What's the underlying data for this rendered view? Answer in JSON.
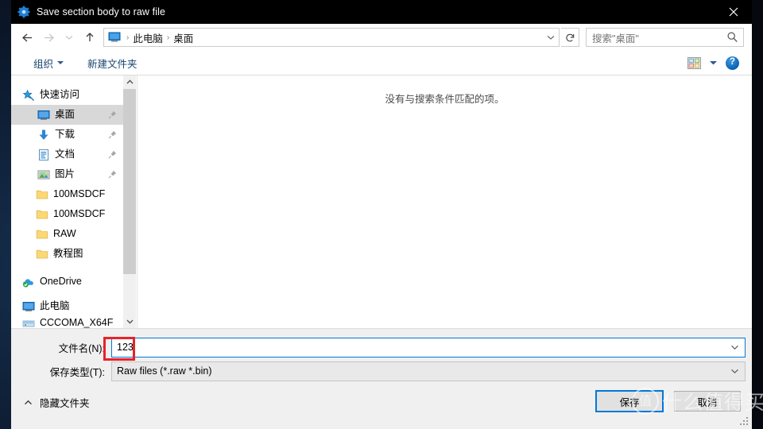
{
  "window": {
    "title": "Save section body to raw file",
    "title_icon": "gear-icon",
    "close_label": "✕"
  },
  "nav": {
    "back_icon": "arrow-left-icon",
    "forward_icon": "arrow-right-icon",
    "recent_icon": "chevron-down-icon",
    "up_icon": "arrow-up-icon",
    "breadcrumb": [
      {
        "label": "此电脑"
      },
      {
        "label": "桌面"
      }
    ],
    "separator": "›",
    "refresh_icon": "refresh-icon",
    "search_placeholder": "搜索\"桌面\"",
    "search_icon": "search-icon"
  },
  "toolbar": {
    "organize_label": "组织",
    "new_folder_label": "新建文件夹",
    "view_icon": "view-layout-icon",
    "view_dropdown_icon": "chevron-down-icon",
    "help_label": "?",
    "help_icon": "help-icon"
  },
  "sidebar": {
    "items": [
      {
        "label": "快速访问",
        "icon": "star-pin-icon",
        "level": 1,
        "selected": false,
        "pinned": false
      },
      {
        "label": "桌面",
        "icon": "desktop-icon",
        "level": 2,
        "selected": true,
        "pinned": true
      },
      {
        "label": "下载",
        "icon": "download-icon",
        "level": 2,
        "selected": false,
        "pinned": true
      },
      {
        "label": "文档",
        "icon": "document-icon",
        "level": 2,
        "selected": false,
        "pinned": true
      },
      {
        "label": "图片",
        "icon": "pictures-icon",
        "level": 2,
        "selected": false,
        "pinned": true
      },
      {
        "label": "100MSDCF",
        "icon": "folder-icon",
        "level": 2,
        "selected": false,
        "pinned": false
      },
      {
        "label": "100MSDCF",
        "icon": "folder-icon",
        "level": 2,
        "selected": false,
        "pinned": false
      },
      {
        "label": "RAW",
        "icon": "folder-icon",
        "level": 2,
        "selected": false,
        "pinned": false
      },
      {
        "label": "教程图",
        "icon": "folder-icon",
        "level": 2,
        "selected": false,
        "pinned": false
      },
      {
        "label": "OneDrive",
        "icon": "onedrive-icon",
        "level": 1,
        "selected": false,
        "pinned": false
      },
      {
        "label": "此电脑",
        "icon": "thispc-icon",
        "level": 1,
        "selected": false,
        "pinned": false
      }
    ],
    "clipped_item": {
      "label": "CCCOMA_X64F",
      "icon": "drive-icon"
    },
    "scroll_up_icon": "chevron-up-icon",
    "scroll_down_icon": "chevron-down-icon"
  },
  "content": {
    "empty_message": "没有与搜索条件匹配的项。"
  },
  "form": {
    "filename_label": "文件名(N):",
    "filename_value": "123",
    "savetype_label": "保存类型(T):",
    "savetype_value": "Raw files (*.raw *.bin)",
    "dropdown_icon": "chevron-down-icon"
  },
  "footer": {
    "hide_folders_label": "隐藏文件夹",
    "hide_folders_icon": "chevron-up-icon",
    "save_label": "保存",
    "cancel_label": "取消",
    "resize_grip_icon": "resize-grip-icon"
  },
  "annotation": {
    "highlight_color": "#e8222a",
    "target": "filename_value"
  },
  "watermark": {
    "logo_char": "值",
    "text": "什么值得买"
  }
}
